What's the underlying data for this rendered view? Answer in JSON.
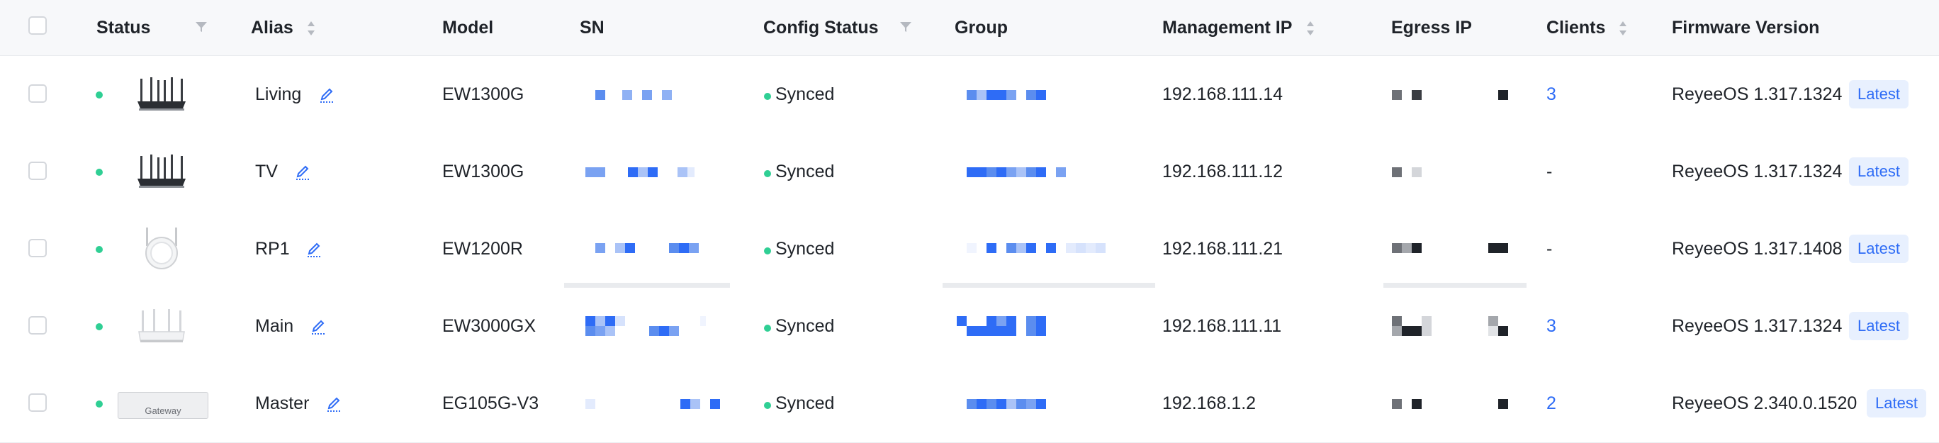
{
  "columns": {
    "status": "Status",
    "alias": "Alias",
    "model": "Model",
    "sn": "SN",
    "config_status": "Config Status",
    "group": "Group",
    "management_ip": "Management IP",
    "egress_ip": "Egress IP",
    "clients": "Clients",
    "firmware": "Firmware Version"
  },
  "colors": {
    "online": "#2fcf94",
    "synced": "#2fcf94",
    "link": "#2e6cf6",
    "badge_bg": "#e8f0fe",
    "mask_blue": "#2e6cf6",
    "mask_dark": "#1f2329"
  },
  "rows": [
    {
      "alias": "Living",
      "model": "EW1300G",
      "config_status": "Synced",
      "management_ip": "192.168.111.14",
      "clients": "3",
      "firmware": "ReyeeOS 1.317.1324",
      "badge": "Latest",
      "device_icon": "router-antennas-icon"
    },
    {
      "alias": "TV",
      "model": "EW1300G",
      "config_status": "Synced",
      "management_ip": "192.168.111.12",
      "clients": "-",
      "firmware": "ReyeeOS 1.317.1324",
      "badge": "Latest",
      "device_icon": "router-antennas-icon"
    },
    {
      "alias": "RP1",
      "model": "EW1200R",
      "config_status": "Synced",
      "management_ip": "192.168.111.21",
      "clients": "-",
      "firmware": "ReyeeOS 1.317.1408",
      "badge": "Latest",
      "device_icon": "repeater-icon"
    },
    {
      "alias": "Main",
      "model": "EW3000GX",
      "config_status": "Synced",
      "management_ip": "192.168.111.11",
      "clients": "3",
      "firmware": "ReyeeOS 1.317.1324",
      "badge": "Latest",
      "device_icon": "router-white-icon"
    },
    {
      "alias": "Master",
      "model": "EG105G-V3",
      "config_status": "Synced",
      "management_ip": "192.168.1.2",
      "clients": "2",
      "firmware": "ReyeeOS 2.340.0.1520",
      "badge": "Latest",
      "device_icon": "gateway-icon",
      "device_label": "Gateway"
    }
  ]
}
